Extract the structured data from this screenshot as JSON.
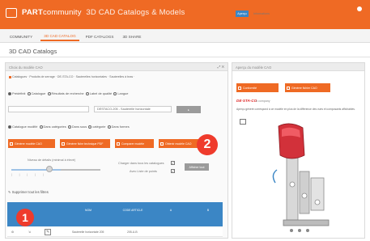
{
  "app": {
    "brand": "PART",
    "brand_suffix": "community",
    "tagline": "3D CAD Catalogs & Models"
  },
  "nav": {
    "tabs": [
      {
        "label": "COMMUNITY",
        "active": false
      },
      {
        "label": "3D CAD CATALOG",
        "active": true
      },
      {
        "label": "PDF CATALOGS",
        "active": false
      },
      {
        "label": "3D SHARE",
        "active": false
      }
    ]
  },
  "page": {
    "title": "3D CAD Catalogs"
  },
  "left": {
    "panel_title": "Choix du modèle CAO",
    "crumbs": "Catalogues · Produits de serrage · DE-STA-CO · Sauterelles horizontales · Sauterelles à bras ·",
    "radios1": [
      "Prédéfinit",
      "Catalogue",
      "Résultats de recherche",
      "Label de qualité",
      "Langue"
    ],
    "radios2": [
      "Catalogue modifié",
      "Dans catégories",
      "Dans sous",
      "catégorie",
      "Dans formes"
    ],
    "field1": "",
    "field2": "DESTACO-205 - Sauterelle horizontale",
    "buttons": [
      "Générer modèle CAO",
      "Générer fiche technique PDF",
      "Comparer modèle",
      "Obtenir modèle CAO"
    ],
    "slider_label": "Niveau de détails (minimal à élevé)",
    "slider": {
      "value_fraction": 0.55
    },
    "options": [
      {
        "label": "Charger dans tous les catalogues",
        "checked": true
      },
      {
        "label": "Avec Liste de points",
        "checked": true
      }
    ],
    "side_button": "Afficher tout",
    "section_title": "Supprimer tout les filtres",
    "table": {
      "headers": [
        "",
        "",
        "",
        "NOM",
        "CODE ARTICLE",
        "A",
        "B"
      ],
      "row": [
        "",
        "",
        "",
        "Sauterelle horizontale 205",
        "205-U-B",
        "",
        ""
      ]
    }
  },
  "right": {
    "panel_title": "Aperçu du modèle CAO",
    "tabs": [
      "Aperçu",
      "Informations"
    ],
    "buttons": [
      "Conformité",
      "Générer fichier CAO"
    ],
    "logo": "DE·STA·CO",
    "logo_sub": "a company",
    "note": "Aperçu généré correspond à ce modèle en plus de la différence des vues et composants affichables.",
    "colors": {
      "body": "#e0e0e0",
      "handle": "#d2313a"
    }
  },
  "annotations": {
    "one": "1",
    "two": "2"
  },
  "colors": {
    "accent": "#ef6a24",
    "table_header": "#3b86c5",
    "badge": "#ef3b2c"
  }
}
